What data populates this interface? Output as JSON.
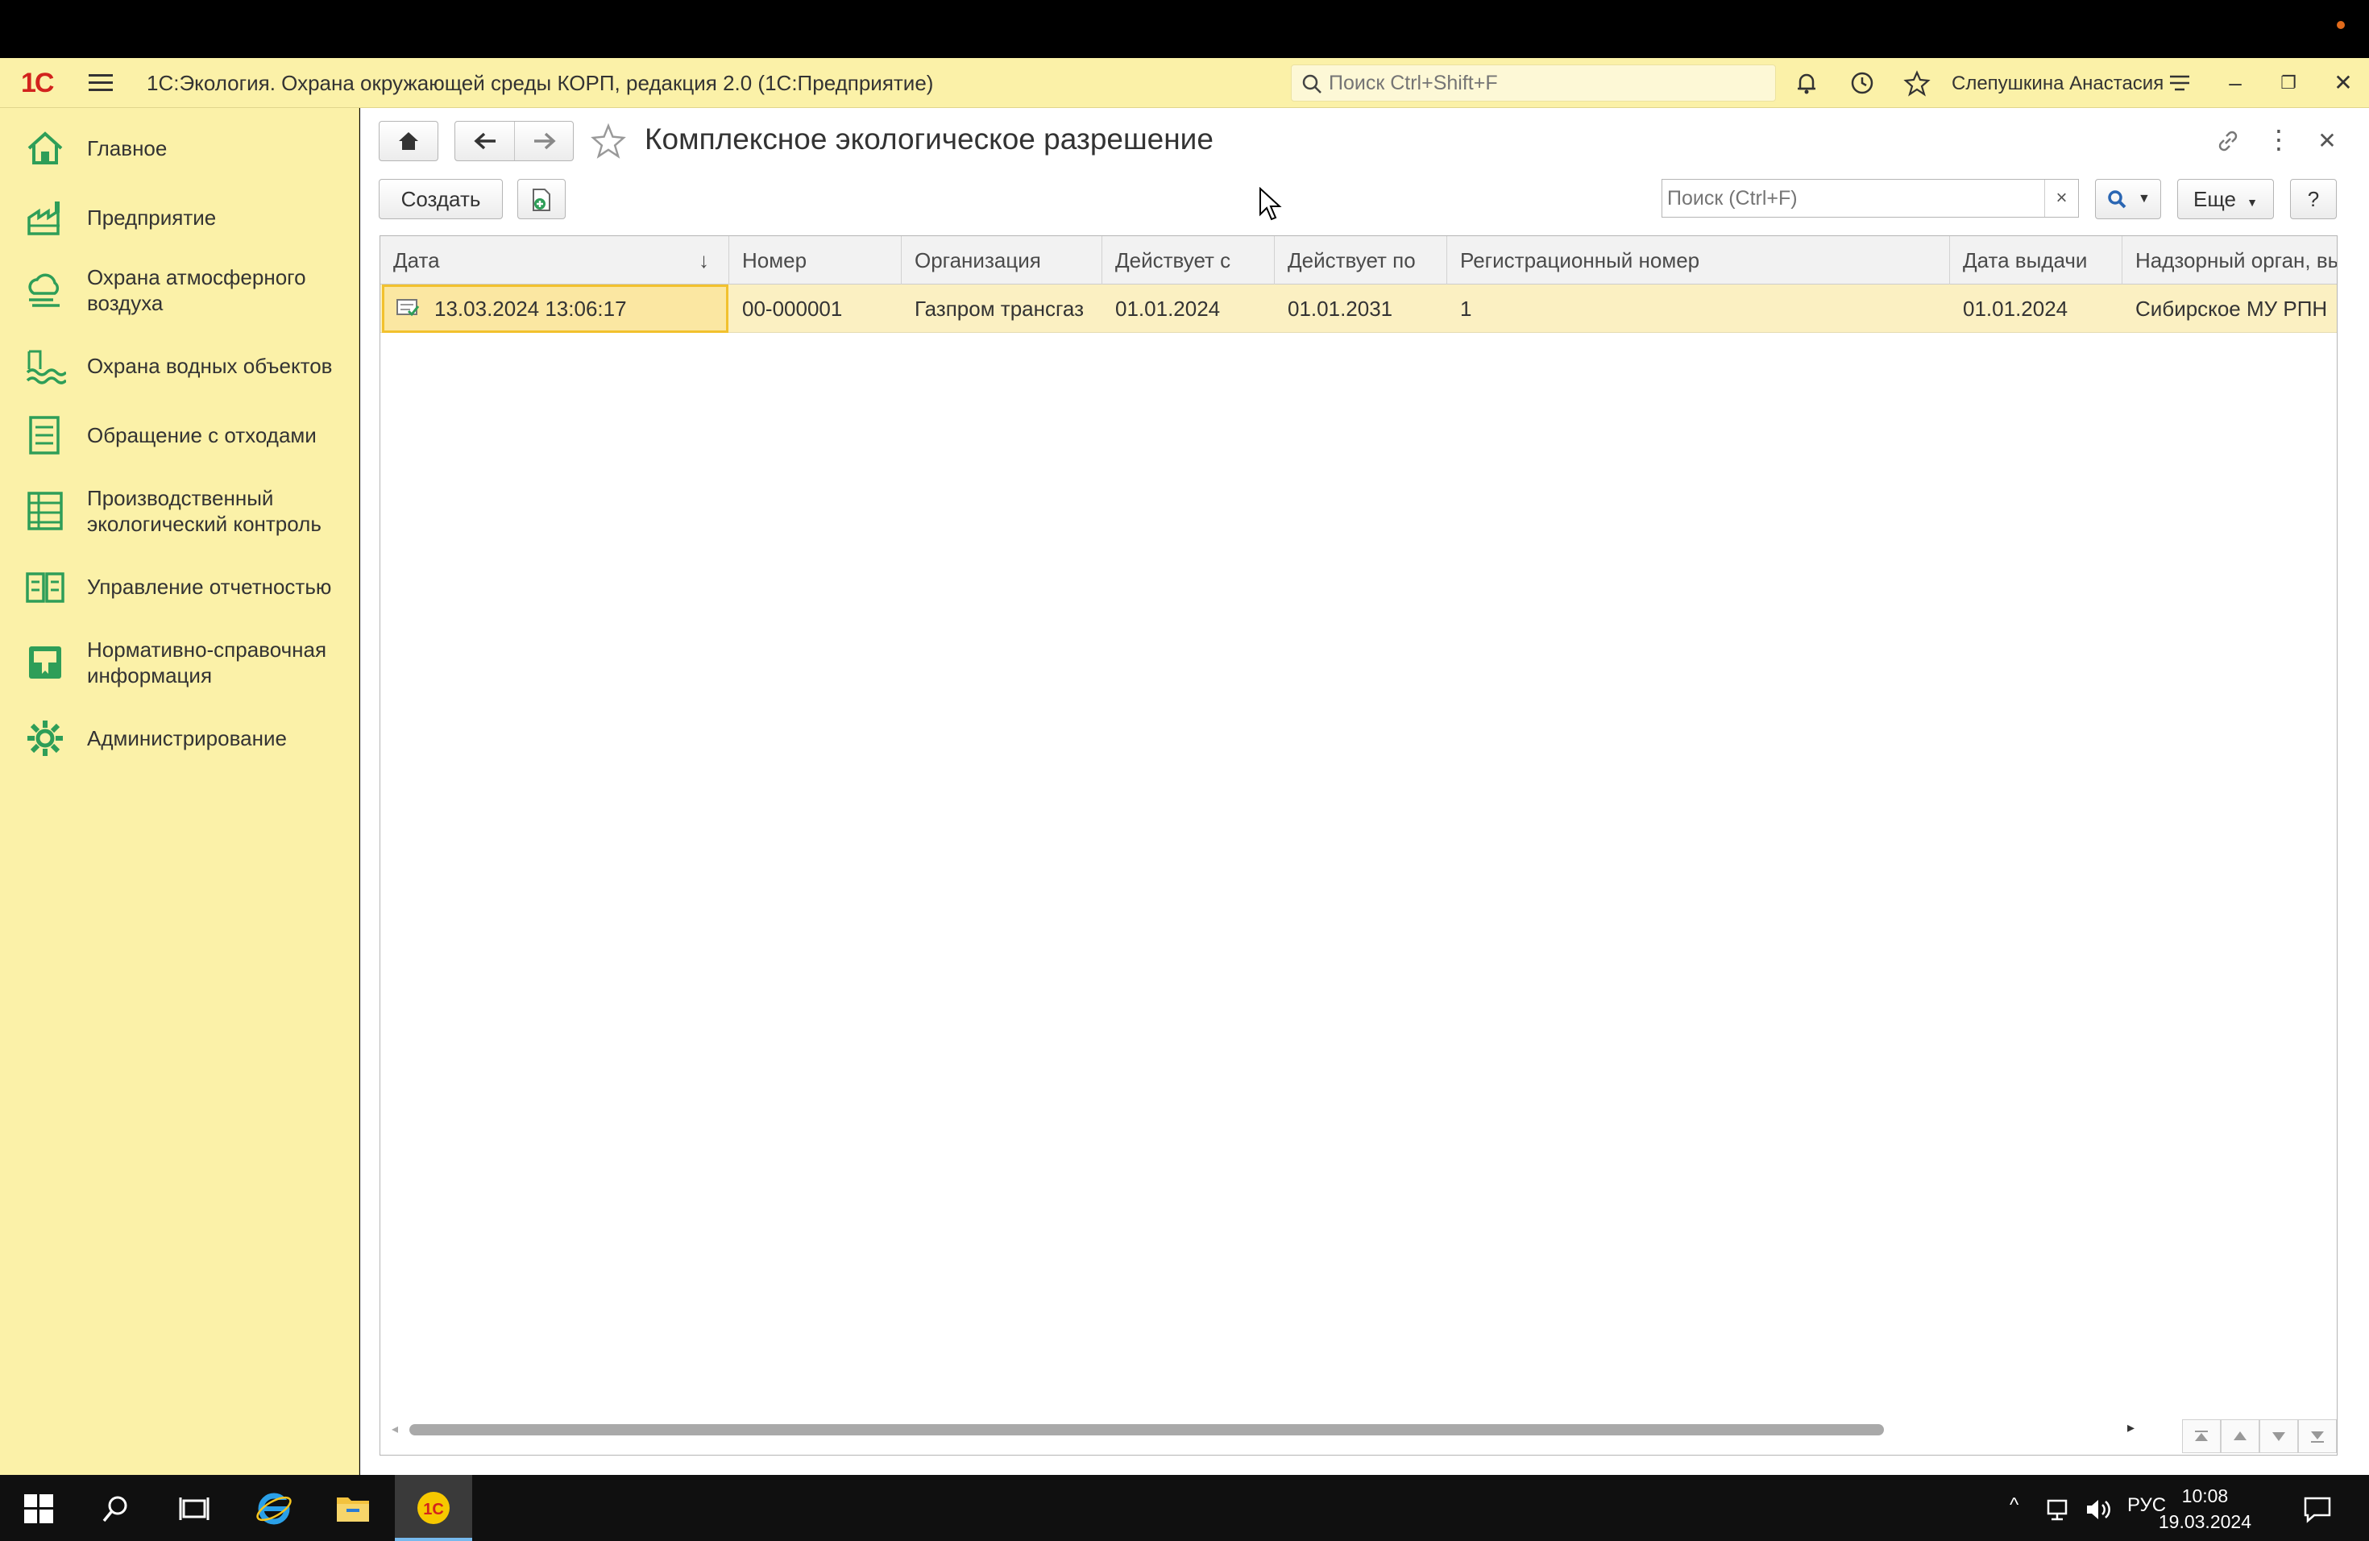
{
  "app": {
    "title": "1С:Экология. Охрана окружающей среды КОРП, редакция 2.0  (1С:Предприятие)",
    "global_search_placeholder": "Поиск Ctrl+Shift+F",
    "user": "Слепушкина Анастасия",
    "accent_color": "#fbf1a8",
    "logo_color": "#d2231d",
    "logo_text": "1С"
  },
  "sidebar": {
    "items": [
      {
        "label": "Главное",
        "icon": "home-icon"
      },
      {
        "label": "Предприятие",
        "icon": "factory-icon"
      },
      {
        "label": "Охрана атмосферного воздуха",
        "icon": "air-cloud-icon"
      },
      {
        "label": "Охрана водных объектов",
        "icon": "water-waves-icon"
      },
      {
        "label": "Обращение с отходами",
        "icon": "waste-list-icon"
      },
      {
        "label": "Производственный экологический контроль",
        "icon": "control-grid-icon"
      },
      {
        "label": "Управление отчетностью",
        "icon": "reports-book-icon"
      },
      {
        "label": "Нормативно-справочная информация",
        "icon": "reference-book-icon"
      },
      {
        "label": "Администрирование",
        "icon": "gear-icon"
      }
    ]
  },
  "form": {
    "title": "Комплексное экологическое разрешение",
    "create_label": "Создать",
    "search_placeholder": "Поиск (Ctrl+F)",
    "clear_label": "×",
    "more_label": "Еще",
    "help_label": "?"
  },
  "table": {
    "columns": [
      "Дата",
      "Номер",
      "Организация",
      "Действует с",
      "Действует по",
      "Регистрационный номер",
      "Дата выдачи",
      "Надзорный орган, вы"
    ],
    "sort_indicator": "↓",
    "rows": [
      {
        "date": "13.03.2024 13:06:17",
        "number": "00-000001",
        "organization": "Газпром трансгаз",
        "valid_from": "01.01.2024",
        "valid_to": "01.01.2031",
        "reg_number": "1",
        "issue_date": "01.01.2024",
        "authority": "Сибирское МУ РПН"
      }
    ]
  },
  "taskbar": {
    "lang": "РУС",
    "time": "10:08",
    "date": "19.03.2024"
  }
}
